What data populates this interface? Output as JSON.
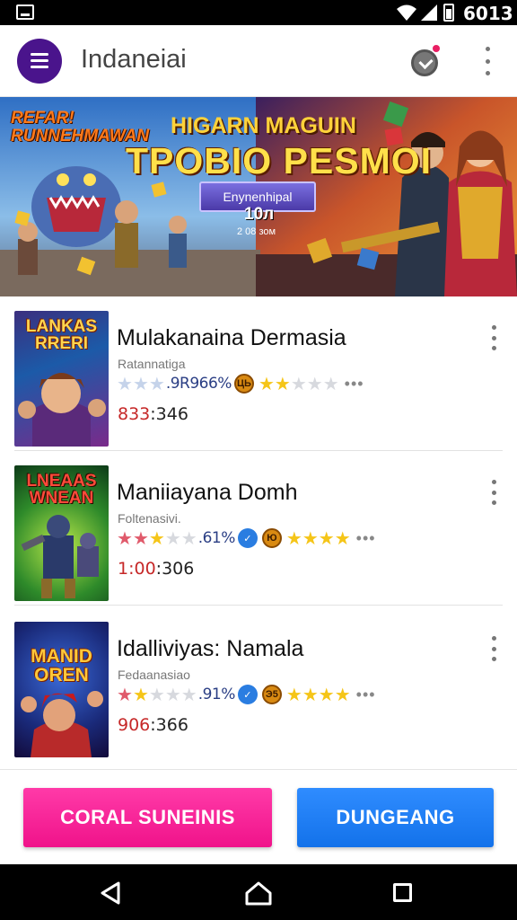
{
  "status_bar": {
    "time": "6013"
  },
  "app_bar": {
    "title": "Indaneiai"
  },
  "banner": {
    "brand": "REFAR! RUNNEHMAWAN",
    "title_line1": "HIGARN MAGUIN",
    "title_line2": "TPOBIO PESMOI",
    "ribbon": "Enynenhipal",
    "number": "10л",
    "sub": "2 08 зом"
  },
  "games": [
    {
      "cover_title": "LANKAS RRERI",
      "name": "Mulakanaina Dermasia",
      "subtitle": "Ratannatiga",
      "percent": ".9R966%",
      "badge": "ЦЬ",
      "count_highlight": "833",
      "count_rest": ":346"
    },
    {
      "cover_title": "LNEAAS WNEAN",
      "name": "Maniiayana Domh",
      "subtitle": "Foltenasivi.",
      "percent": ".61%",
      "badge": "Ю",
      "count_highlight": "1:00",
      "count_rest": ":306"
    },
    {
      "cover_title": "MANID OREN",
      "name": "Idalliviyas: Namala",
      "subtitle": "Fedaanasiao",
      "percent": ".91%",
      "badge": "Э5",
      "count_highlight": "906",
      "count_rest": ":366"
    }
  ],
  "footer": {
    "primary_label": "CORAL SUNEINIS",
    "secondary_label": "DUNGEANG"
  },
  "colors": {
    "menu_button": "#4a148c",
    "primary_button": "#f0138a",
    "secondary_button": "#1372ea",
    "count_highlight": "#c62828"
  },
  "icons": [
    "menu-icon",
    "achievement-icon",
    "more-vert-icon",
    "star-icon",
    "back-icon",
    "home-icon",
    "recent-apps-icon"
  ]
}
